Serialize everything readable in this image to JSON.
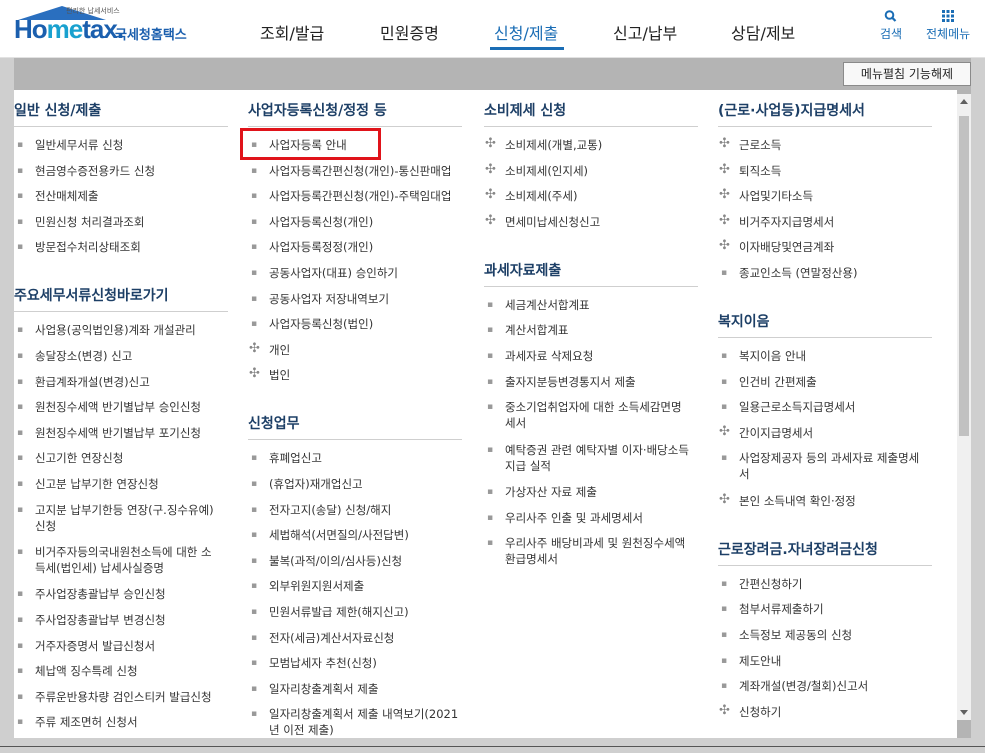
{
  "header": {
    "logo_word_1": "Ho",
    "logo_word_2": "me",
    "logo_word_3": "tax.",
    "logo_korean": "국세청홈택스",
    "logo_tagline": "편리한 납세서비스",
    "nav": [
      "조회/발급",
      "민원증명",
      "신청/제출",
      "신고/납부",
      "상담/제보"
    ],
    "active_nav_index": 2,
    "search_label": "검색",
    "full_menu_label": "전체메뉴",
    "accent_color": "#1a6db5"
  },
  "collapse_button_label": "메뉴펼침 기능해제",
  "columns": [
    {
      "sections": [
        {
          "title": "일반 신청/제출",
          "items": [
            {
              "text": "일반세무서류 신청",
              "type": "bullet"
            },
            {
              "text": "현금영수증전용카드 신청",
              "type": "bullet"
            },
            {
              "text": "전산매체제출",
              "type": "bullet"
            },
            {
              "text": "민원신청 처리결과조회",
              "type": "bullet"
            },
            {
              "text": "방문접수처리상태조회",
              "type": "bullet"
            }
          ]
        },
        {
          "title": "주요세무서류신청바로가기",
          "items": [
            {
              "text": "사업용(공익법인용)계좌 개설관리",
              "type": "bullet"
            },
            {
              "text": "송달장소(변경) 신고",
              "type": "bullet"
            },
            {
              "text": "환급계좌개설(변경)신고",
              "type": "bullet"
            },
            {
              "text": "원천징수세액 반기별납부 승인신청",
              "type": "bullet"
            },
            {
              "text": "원천징수세액 반기별납부 포기신청",
              "type": "bullet"
            },
            {
              "text": "신고기한 연장신청",
              "type": "bullet"
            },
            {
              "text": "신고분 납부기한 연장신청",
              "type": "bullet"
            },
            {
              "text": "고지분 납부기한등 연장(구.징수유예)",
              "text2": "신청",
              "type": "bullet"
            },
            {
              "text": "비거주자등의국내원천소득에 대한 소",
              "text2": "득세(법인세) 납세사실증명",
              "type": "bullet"
            },
            {
              "text": "주사업장총괄납부 승인신청",
              "type": "bullet"
            },
            {
              "text": "주사업장총괄납부 변경신청",
              "type": "bullet"
            },
            {
              "text": "거주자증명서 발급신청서",
              "type": "bullet"
            },
            {
              "text": "체납액 징수특례 신청",
              "type": "bullet"
            },
            {
              "text": "주류운반용차량 검인스티커 발급신청",
              "type": "bullet"
            },
            {
              "text": "주류 제조면허 신청서",
              "type": "bullet"
            }
          ]
        }
      ]
    },
    {
      "sections": [
        {
          "title": "사업자등록신청/정정 등",
          "items": [
            {
              "text": "사업자등록 안내",
              "type": "bullet"
            },
            {
              "text": "사업자등록간편신청(개인)-통신판매업",
              "type": "bullet"
            },
            {
              "text": "사업자등록간편신청(개인)-주택임대업",
              "type": "bullet"
            },
            {
              "text": "사업자등록신청(개인)",
              "type": "bullet"
            },
            {
              "text": "사업자등록정정(개인)",
              "type": "bullet"
            },
            {
              "text": "공동사업자(대표) 승인하기",
              "type": "bullet"
            },
            {
              "text": "공동사업자 저장내역보기",
              "type": "bullet"
            },
            {
              "text": "사업자등록신청(법인)",
              "type": "bullet"
            },
            {
              "text": "개인",
              "type": "plus"
            },
            {
              "text": "법인",
              "type": "plus"
            }
          ]
        },
        {
          "title": "신청업무",
          "items": [
            {
              "text": "휴폐업신고",
              "type": "bullet"
            },
            {
              "text": "(휴업자)재개업신고",
              "type": "bullet"
            },
            {
              "text": "전자고지(송달) 신청/해지",
              "type": "bullet"
            },
            {
              "text": "세법해석(서면질의/사전답변)",
              "type": "bullet"
            },
            {
              "text": "불복(과적/이의/심사등)신청",
              "type": "bullet"
            },
            {
              "text": "외부위원지원서제출",
              "type": "bullet"
            },
            {
              "text": "민원서류발급 제한(해지신고)",
              "type": "bullet"
            },
            {
              "text": "전자(세금)계산서자료신청",
              "type": "bullet"
            },
            {
              "text": "모범납세자 추천(신청)",
              "type": "bullet"
            },
            {
              "text": "일자리창출계획서 제출",
              "type": "bullet"
            },
            {
              "text": "일자리창출계획서 제출 내역보기(2021",
              "text2": "년 이전 제출)",
              "type": "bullet"
            }
          ]
        }
      ]
    },
    {
      "sections": [
        {
          "title": "소비제세 신청",
          "items": [
            {
              "text": "소비제세(개별,교통)",
              "type": "plus"
            },
            {
              "text": "소비제세(인지세)",
              "type": "plus"
            },
            {
              "text": "소비제세(주세)",
              "type": "plus"
            },
            {
              "text": "면세미납세신청신고",
              "type": "plus"
            }
          ]
        },
        {
          "title": "과세자료제출",
          "items": [
            {
              "text": "세금계산서합계표",
              "type": "bullet"
            },
            {
              "text": "계산서합계표",
              "type": "bullet"
            },
            {
              "text": "과세자료 삭제요청",
              "type": "bullet"
            },
            {
              "text": "출자지분등변경통지서 제출",
              "type": "bullet"
            },
            {
              "text": "중소기업취업자에 대한 소득세감면명",
              "text2": "세서",
              "type": "bullet"
            },
            {
              "text": "예탁증권 관련 예탁자별 이자·배당소득",
              "text2": "지급 실적",
              "type": "bullet"
            },
            {
              "text": "가상자산 자료 제출",
              "type": "bullet"
            },
            {
              "text": "우리사주 인출 및 과세명세서",
              "type": "bullet"
            },
            {
              "text": "우리사주 배당비과세 및 원천징수세액",
              "text2": "환급명세서",
              "type": "bullet"
            }
          ]
        }
      ]
    },
    {
      "sections": [
        {
          "title": "(근로·사업등)지급명세서",
          "items": [
            {
              "text": "근로소득",
              "type": "plus"
            },
            {
              "text": "퇴직소득",
              "type": "plus"
            },
            {
              "text": "사업및기타소득",
              "type": "plus"
            },
            {
              "text": "비거주자지급명세서",
              "type": "plus"
            },
            {
              "text": "이자배당및연금계좌",
              "type": "plus"
            },
            {
              "text": "종교인소득 (연말정산용)",
              "type": "bullet"
            }
          ]
        },
        {
          "title": "복지이음",
          "items": [
            {
              "text": "복지이음 안내",
              "type": "bullet"
            },
            {
              "text": "인건비 간편제출",
              "type": "bullet"
            },
            {
              "text": "일용근로소득지급명세서",
              "type": "bullet"
            },
            {
              "text": "간이지급명세서",
              "type": "plus"
            },
            {
              "text": "사업장제공자 등의 과세자료 제출명세",
              "text2": "서",
              "type": "bullet"
            },
            {
              "text": "본인 소득내역 확인·정정",
              "type": "plus"
            }
          ]
        },
        {
          "title": "근로장려금.자녀장려금신청",
          "items": [
            {
              "text": "간편신청하기",
              "type": "bullet"
            },
            {
              "text": "첨부서류제출하기",
              "type": "bullet"
            },
            {
              "text": "소득정보 제공동의 신청",
              "type": "bullet"
            },
            {
              "text": "제도안내",
              "type": "bullet"
            },
            {
              "text": "계좌개설(변경/철회)신고서",
              "type": "bullet"
            },
            {
              "text": "신청하기",
              "type": "plus"
            }
          ]
        }
      ]
    }
  ]
}
